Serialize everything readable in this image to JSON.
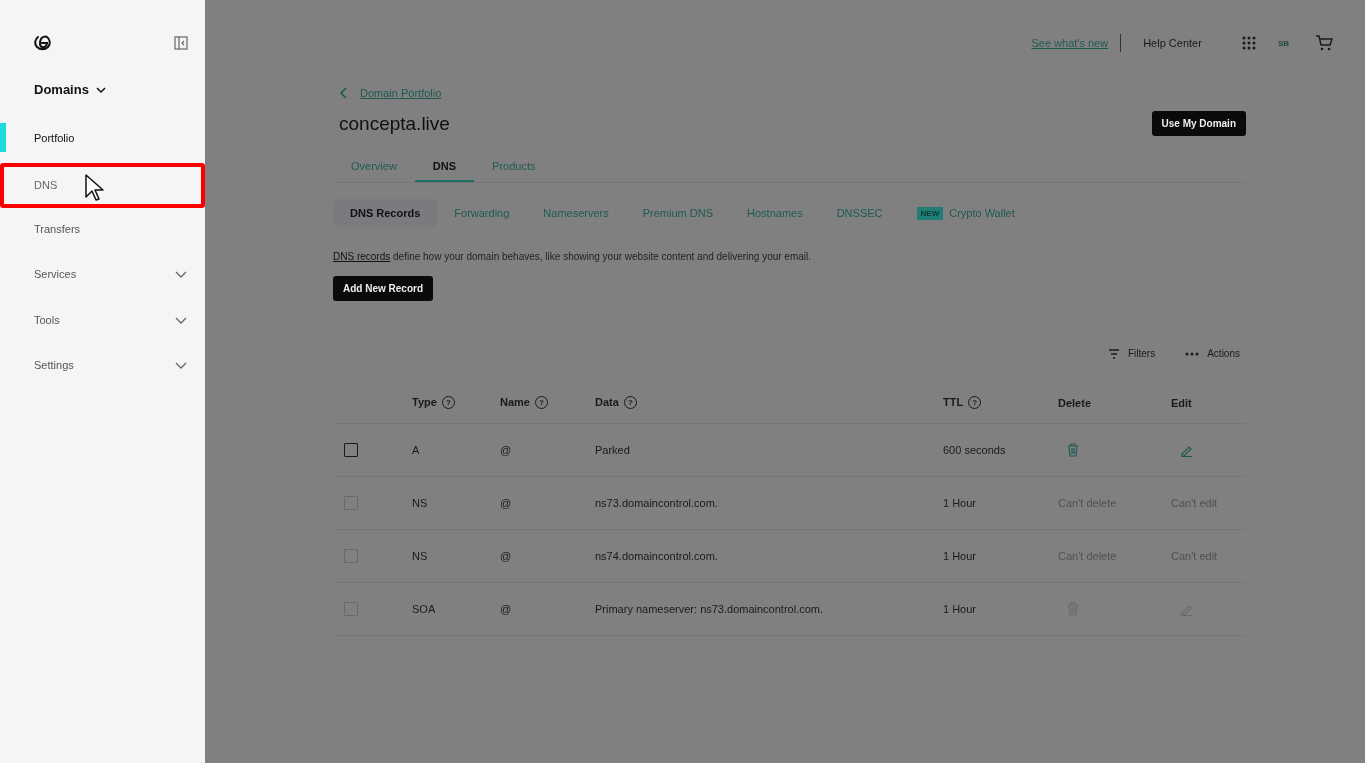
{
  "sidebar": {
    "section": {
      "label": "Domains",
      "expanded": true
    },
    "items": [
      {
        "label": "Portfolio",
        "selected": true,
        "highlighted": false,
        "has_children": false
      },
      {
        "label": "DNS",
        "selected": false,
        "highlighted": true,
        "has_children": false
      },
      {
        "label": "Transfers",
        "selected": false,
        "highlighted": false,
        "has_children": false
      },
      {
        "label": "Services",
        "selected": false,
        "highlighted": false,
        "has_children": true
      },
      {
        "label": "Tools",
        "selected": false,
        "highlighted": false,
        "has_children": true
      },
      {
        "label": "Settings",
        "selected": false,
        "highlighted": false,
        "has_children": true
      }
    ]
  },
  "top_bar": {
    "whats_new": "See what's new",
    "help": "Help Center",
    "avatar": "SB"
  },
  "breadcrumb": "Domain Portfolio",
  "title": "concepta.live",
  "primary_action": "Use My Domain",
  "tabs": [
    {
      "label": "Overview",
      "selected": false
    },
    {
      "label": "DNS",
      "selected": true
    },
    {
      "label": "Products",
      "selected": false
    }
  ],
  "subtabs": [
    {
      "label": "DNS Records",
      "selected": true
    },
    {
      "label": "Forwarding",
      "selected": false
    },
    {
      "label": "Nameservers",
      "selected": false
    },
    {
      "label": "Premium DNS",
      "selected": false
    },
    {
      "label": "Hostnames",
      "selected": false
    },
    {
      "label": "DNSSEC",
      "selected": false
    },
    {
      "label": "Crypto Wallet",
      "selected": false,
      "badge": "NEW"
    }
  ],
  "intro": {
    "link": "DNS records",
    "text": "define how your domain behaves, like showing your website content and delivering your email."
  },
  "add_button": "Add New Record",
  "toolbar": {
    "filters": "Filters",
    "actions": "Actions"
  },
  "table": {
    "columns": [
      {
        "label": "Type",
        "help": "?"
      },
      {
        "label": "Name",
        "help": "?"
      },
      {
        "label": "Data",
        "help": "?"
      },
      {
        "label": "TTL",
        "help": "?"
      },
      {
        "label": "Delete"
      },
      {
        "label": "Edit"
      }
    ],
    "rows": [
      {
        "type": "A",
        "name": "@",
        "data": "Parked",
        "ttl": "600 seconds",
        "disabled": false,
        "delete": {
          "kind": "icon",
          "disabled": false
        },
        "edit": {
          "kind": "icon",
          "disabled": false
        }
      },
      {
        "type": "NS",
        "name": "@",
        "data": "ns73.domaincontrol.com.",
        "ttl": "1 Hour",
        "disabled": true,
        "delete": {
          "kind": "text",
          "label": "Can't delete"
        },
        "edit": {
          "kind": "text",
          "label": "Can't edit"
        }
      },
      {
        "type": "NS",
        "name": "@",
        "data": "ns74.domaincontrol.com.",
        "ttl": "1 Hour",
        "disabled": true,
        "delete": {
          "kind": "text",
          "label": "Can't delete"
        },
        "edit": {
          "kind": "text",
          "label": "Can't edit"
        }
      },
      {
        "type": "SOA",
        "name": "@",
        "data": "Primary nameserver: ns73.domaincontrol.com.",
        "ttl": "1 Hour",
        "disabled": true,
        "delete": {
          "kind": "icon",
          "disabled": true
        },
        "edit": {
          "kind": "icon",
          "disabled": true
        }
      }
    ]
  }
}
